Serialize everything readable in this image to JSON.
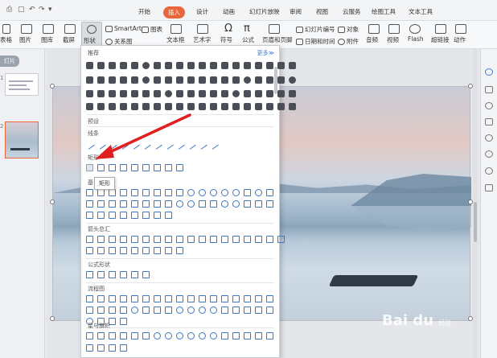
{
  "tabs": [
    {
      "id": "start",
      "label": "开始"
    },
    {
      "id": "insert",
      "label": "插入"
    },
    {
      "id": "design",
      "label": "设计"
    },
    {
      "id": "animation",
      "label": "动画"
    },
    {
      "id": "slideshow",
      "label": "幻灯片放映"
    },
    {
      "id": "review",
      "label": "审阅"
    },
    {
      "id": "view",
      "label": "视图"
    },
    {
      "id": "cloud",
      "label": "云服务"
    },
    {
      "id": "drawing",
      "label": "绘图工具"
    },
    {
      "id": "text",
      "label": "文本工具"
    }
  ],
  "ribbon": {
    "table": "表格",
    "picture": "图片",
    "gallery": "图库",
    "screenshot": "截屏",
    "shape": "形状",
    "smartart": "SmartArt",
    "chart": "图表",
    "relation": "关系图",
    "textbox": "文本框",
    "wordart": "艺术字",
    "symbol": "符号",
    "formula": "公式",
    "slide_number": "幻灯片编号",
    "header_footer": "页眉和页脚",
    "datetime": "日期和时间",
    "object": "对象",
    "attachment": "附件",
    "audio": "音频",
    "video": "视频",
    "flash": "Flash",
    "hyperlink": "超链接",
    "action": "动作"
  },
  "left_panel": {
    "tag": "灯片"
  },
  "thumbs": {
    "one": "1",
    "two": "2"
  },
  "shapes_panel": {
    "recommended": "推荐",
    "more": "更多≫",
    "presets": "预设",
    "lines": "线条",
    "rectangles": "矩形",
    "basic": "基",
    "arrows": "箭头总汇",
    "equation": "公式形状",
    "flowchart": "流程图",
    "stars": "星与旗帜",
    "tooltip": "矩形"
  },
  "watermark": {
    "brand": "Bai du",
    "sub": "经验"
  },
  "colors": {
    "accent": "#e8663a",
    "shape_outline": "#3c78c3",
    "arrow": "#e02020"
  }
}
